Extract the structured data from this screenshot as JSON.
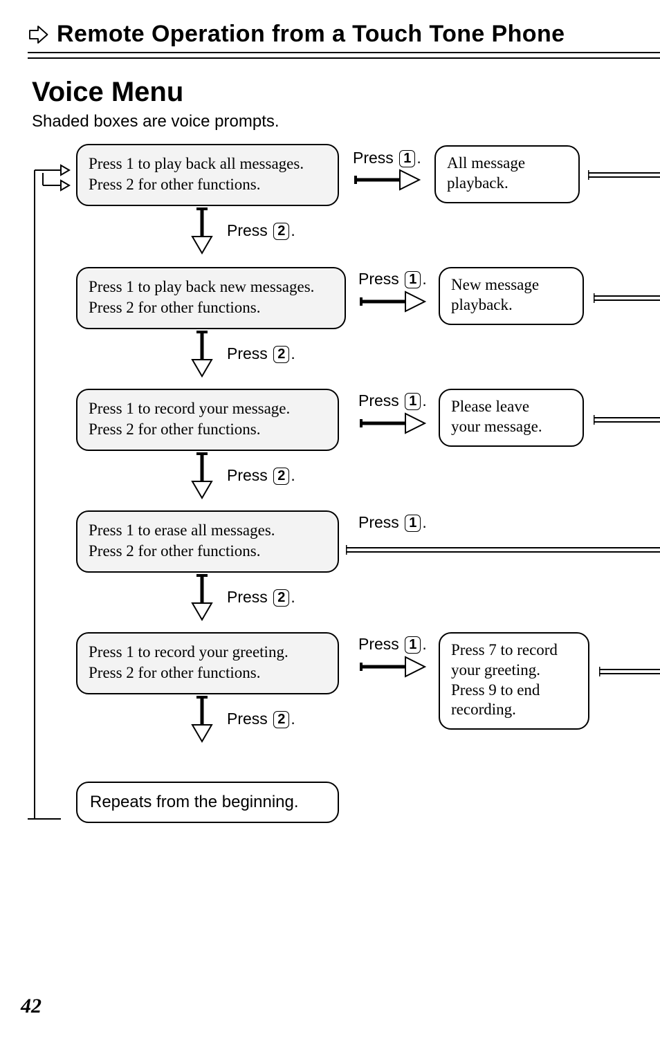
{
  "header": {
    "title": "Remote Operation from a Touch Tone Phone"
  },
  "section": {
    "title": "Voice Menu",
    "note": "Shaded boxes are voice prompts."
  },
  "labels": {
    "press": "Press",
    "period": "."
  },
  "keys": {
    "k1": "1",
    "k2": "2"
  },
  "steps": [
    {
      "prompt_line1": "Press 1 to play back all messages.",
      "prompt_line2": "Press 2 for other functions.",
      "result_line1": "All message",
      "result_line2": "playback."
    },
    {
      "prompt_line1": "Press 1 to play back new messages.",
      "prompt_line2": "Press 2 for other functions.",
      "result_line1": "New message",
      "result_line2": "playback."
    },
    {
      "prompt_line1": "Press 1 to record your message.",
      "prompt_line2": "Press 2 for other functions.",
      "result_line1": "Please leave",
      "result_line2": "your message."
    },
    {
      "prompt_line1": "Press 1 to erase all messages.",
      "prompt_line2": "Press 2 for other functions."
    },
    {
      "prompt_line1": "Press 1 to record your greeting.",
      "prompt_line2": "Press 2 for other functions.",
      "result_line1": "Press 7 to record",
      "result_line2": "your greeting.",
      "result_line3": "Press 9 to end",
      "result_line4": "recording."
    }
  ],
  "final_box": "Repeats from the beginning.",
  "page_number": "42"
}
